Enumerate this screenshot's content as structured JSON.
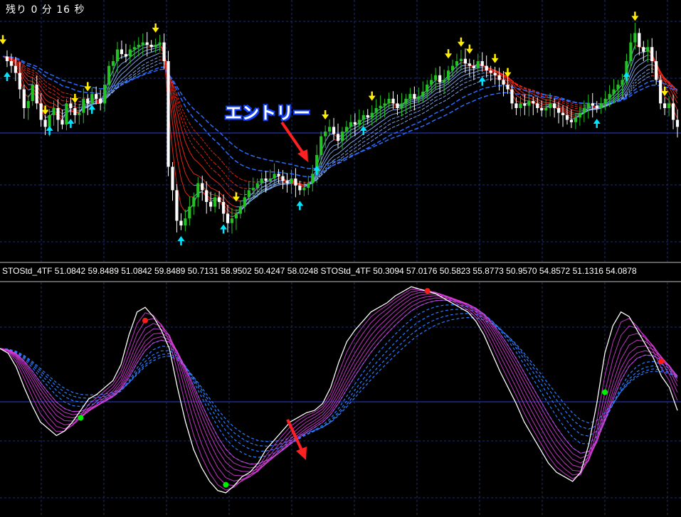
{
  "countdown_text": "残り 0 分 16 秒",
  "annotation": {
    "entry_label": "エントリー"
  },
  "indicator_label": "STOStd_4TF 51.0842 59.8489 51.0842 59.8489 50.7131 58.9502 50.4247 58.0248   STOStd_4TF 50.3094 57.0176 50.5823 55.8773 50.9570 54.8572 51.1316 54.0878",
  "colors": {
    "background": "#000000",
    "bull_candle": "#22c322",
    "bear_candle": "#ffffff",
    "ma_down": "#ff2a1a",
    "ma_up": "#8fb6ff",
    "ma_slow": "#2a6cff",
    "sell_arrow": "#ffee00",
    "buy_arrow": "#00e5ff",
    "stoch_fan": "#e040e0",
    "stoch_main": "#ffffff",
    "stoch_slow": "#2a7cff",
    "dot_green": "#00ee00",
    "dot_red": "#ff1a1a",
    "annotation_arrow": "#ff2020",
    "grid": "#1f2f6e"
  },
  "chart_data": [
    {
      "type": "line",
      "name": "price",
      "x": [
        0,
        1,
        2,
        3,
        4,
        5,
        6,
        7,
        8,
        9,
        10,
        11,
        12,
        13,
        14,
        15,
        16,
        17,
        18,
        19,
        20,
        21,
        22,
        23,
        24,
        25,
        26,
        27,
        28,
        29,
        30,
        31,
        32,
        33,
        34,
        35,
        36,
        37,
        38,
        39,
        40,
        41,
        42,
        43,
        44,
        45,
        46,
        47,
        48,
        49,
        50,
        51,
        52,
        53,
        54,
        55,
        56,
        57,
        58,
        59,
        60,
        61,
        62,
        63,
        64,
        65,
        66,
        67,
        68,
        69,
        70,
        71,
        72,
        73,
        74,
        75,
        76,
        77,
        78,
        79,
        80,
        81,
        82,
        83,
        84,
        85,
        86,
        87,
        88,
        89,
        90,
        91,
        92,
        93,
        94,
        95,
        96,
        97,
        98,
        99,
        100,
        101,
        102,
        103,
        104,
        105,
        106,
        107,
        108,
        109,
        110,
        111,
        112,
        113,
        114,
        115,
        116,
        117,
        118,
        119,
        120,
        121,
        122,
        123,
        124,
        125,
        126,
        127,
        128,
        129,
        130,
        131,
        132,
        133,
        134,
        135,
        136,
        137,
        138,
        139,
        140,
        141,
        142,
        143,
        144,
        145,
        146,
        147,
        148,
        149,
        150,
        151,
        152,
        153,
        154,
        155,
        156,
        157,
        158,
        159
      ],
      "close": [
        0.82,
        0.8,
        0.78,
        0.75,
        0.68,
        0.6,
        0.63,
        0.7,
        0.62,
        0.55,
        0.52,
        0.57,
        0.6,
        0.55,
        0.53,
        0.62,
        0.6,
        0.57,
        0.58,
        0.64,
        0.62,
        0.66,
        0.64,
        0.62,
        0.7,
        0.78,
        0.8,
        0.85,
        0.83,
        0.82,
        0.85,
        0.86,
        0.87,
        0.88,
        0.87,
        0.86,
        0.87,
        0.88,
        0.8,
        0.35,
        0.25,
        0.12,
        0.1,
        0.13,
        0.18,
        0.22,
        0.28,
        0.25,
        0.2,
        0.18,
        0.22,
        0.2,
        0.15,
        0.11,
        0.13,
        0.15,
        0.18,
        0.22,
        0.25,
        0.26,
        0.28,
        0.3,
        0.29,
        0.3,
        0.32,
        0.31,
        0.29,
        0.28,
        0.3,
        0.27,
        0.25,
        0.26,
        0.28,
        0.32,
        0.4,
        0.48,
        0.5,
        0.52,
        0.49,
        0.46,
        0.5,
        0.52,
        0.54,
        0.53,
        0.55,
        0.57,
        0.56,
        0.58,
        0.6,
        0.61,
        0.62,
        0.64,
        0.62,
        0.6,
        0.62,
        0.64,
        0.66,
        0.64,
        0.65,
        0.67,
        0.7,
        0.72,
        0.74,
        0.71,
        0.72,
        0.76,
        0.78,
        0.8,
        0.81,
        0.79,
        0.78,
        0.77,
        0.8,
        0.78,
        0.76,
        0.75,
        0.74,
        0.72,
        0.7,
        0.68,
        0.62,
        0.6,
        0.62,
        0.61,
        0.63,
        0.62,
        0.6,
        0.59,
        0.6,
        0.62,
        0.6,
        0.58,
        0.57,
        0.55,
        0.54,
        0.56,
        0.58,
        0.6,
        0.62,
        0.61,
        0.6,
        0.62,
        0.64,
        0.66,
        0.68,
        0.7,
        0.72,
        0.8,
        0.88,
        0.92,
        0.86,
        0.84,
        0.86,
        0.8,
        0.72,
        0.62,
        0.6,
        0.62,
        0.55,
        0.52
      ]
    },
    {
      "type": "line",
      "name": "stochastic",
      "y_range": [
        0,
        100
      ],
      "values": [
        72,
        70,
        64,
        55,
        47,
        40,
        37,
        34,
        36,
        40,
        45,
        50,
        52,
        55,
        58,
        65,
        78,
        88,
        90,
        86,
        80,
        72,
        55,
        40,
        28,
        20,
        14,
        10,
        9,
        12,
        16,
        18,
        22,
        28,
        32,
        36,
        40,
        42,
        44,
        45,
        48,
        55,
        66,
        75,
        80,
        84,
        88,
        90,
        92,
        95,
        97,
        99,
        98,
        97,
        96,
        94,
        92,
        90,
        88,
        84,
        78,
        70,
        62,
        55,
        48,
        40,
        34,
        28,
        22,
        18,
        16,
        14,
        18,
        30,
        48,
        70,
        82,
        88,
        86,
        80,
        74,
        68,
        60,
        55,
        45
      ]
    }
  ]
}
